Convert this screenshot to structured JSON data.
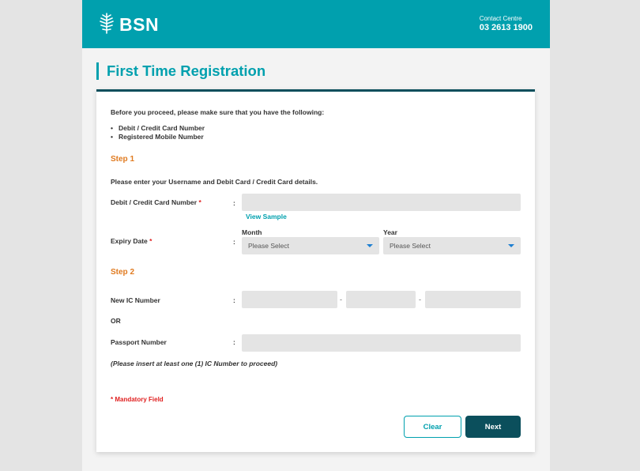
{
  "header": {
    "brand": "BSN",
    "contact_label": "Contact Centre",
    "contact_number": "03 2613 1900",
    "logo_icon": "tree-icon",
    "color": "#00a0ae"
  },
  "page": {
    "title": "First Time Registration"
  },
  "form": {
    "intro": "Before you proceed, please make sure that you have the following:",
    "requirements": [
      "Debit / Credit Card Number",
      "Registered Mobile Number"
    ],
    "step1": {
      "title": "Step 1",
      "instruction": "Please enter your Username and Debit Card / Credit Card details.",
      "card_label": "Debit / Credit Card Number",
      "card_value": "",
      "view_sample": "View Sample",
      "expiry_label": "Expiry Date",
      "month_label": "Month",
      "month_value": "Please Select",
      "year_label": "Year",
      "year_value": "Please Select"
    },
    "step2": {
      "title": "Step 2",
      "ic_label": "New IC Number",
      "ic_part1": "",
      "ic_part2": "",
      "ic_part3": "",
      "ic_separator": "-",
      "or_label": "OR",
      "passport_label": "Passport Number",
      "passport_value": "",
      "note": "(Please insert at least one (1) IC Number to proceed)"
    },
    "required_marker": "*",
    "colon": ":",
    "mandatory_note": "* Mandatory Field"
  },
  "actions": {
    "clear_label": "Clear",
    "next_label": "Next"
  },
  "colors": {
    "accent": "#00a0ae",
    "dark": "#0b4f5c",
    "step": "#e07a1f",
    "required": "#e02020"
  }
}
